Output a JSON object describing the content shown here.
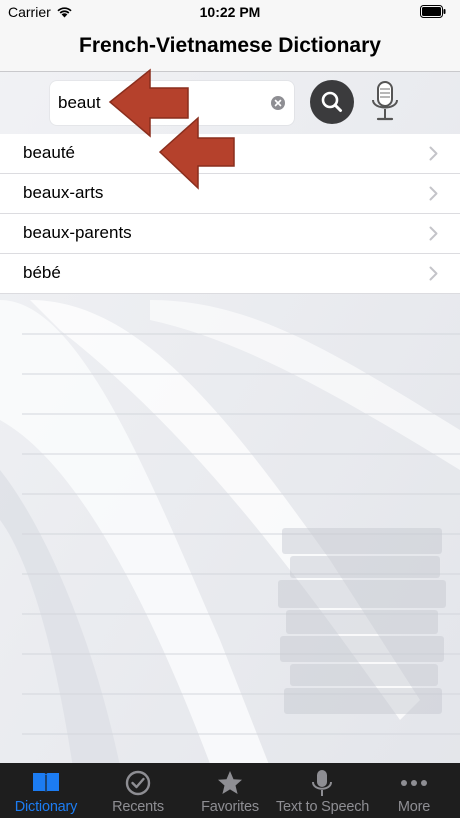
{
  "status_bar": {
    "carrier": "Carrier",
    "time": "10:22 PM"
  },
  "nav": {
    "title": "French-Vietnamese Dictionary"
  },
  "search": {
    "value": "beaut",
    "icons": {
      "clear": "clear-circle-icon",
      "search": "magnifier-icon",
      "mic": "microphone-icon"
    }
  },
  "results": [
    {
      "label": "beauté"
    },
    {
      "label": "beaux-arts"
    },
    {
      "label": "beaux-parents"
    },
    {
      "label": "bébé"
    }
  ],
  "tabs": [
    {
      "label": "Dictionary",
      "icon": "book-icon",
      "active": true
    },
    {
      "label": "Recents",
      "icon": "clock-check-icon",
      "active": false
    },
    {
      "label": "Favorites",
      "icon": "star-icon",
      "active": false
    },
    {
      "label": "Text to Speech",
      "icon": "microphone-icon",
      "active": false
    },
    {
      "label": "More",
      "icon": "ellipsis-icon",
      "active": false
    }
  ],
  "colors": {
    "accent": "#1c7cf2",
    "tab_bar": "#1e1e1e",
    "arrow": "#b5412c",
    "search_button": "#3b3b3d"
  }
}
